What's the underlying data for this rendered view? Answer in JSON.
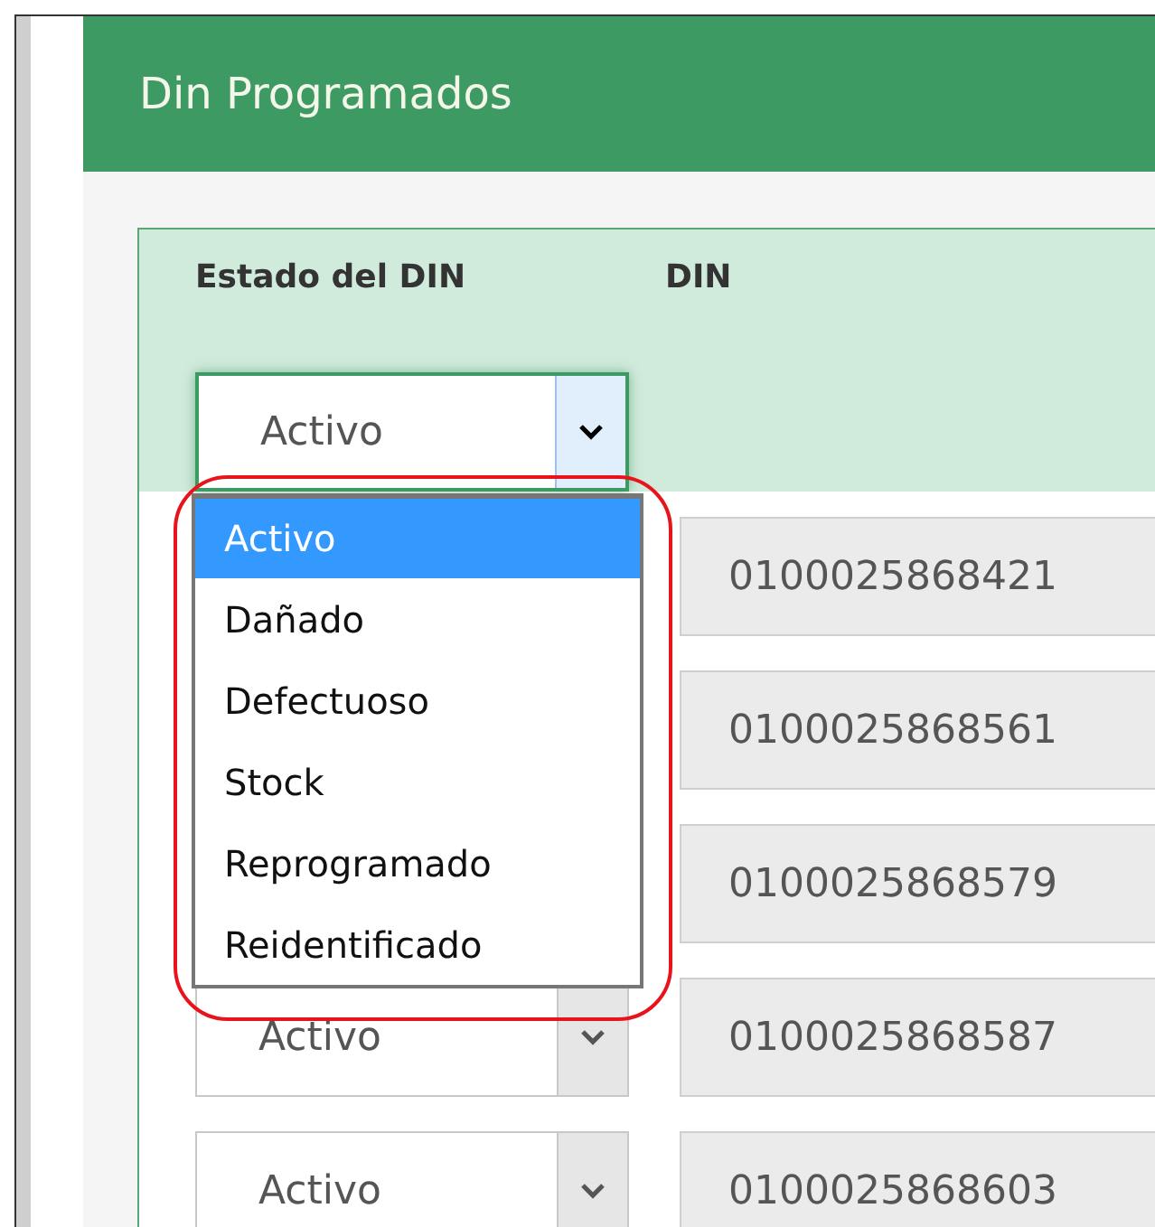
{
  "panel": {
    "title": "Din Programados"
  },
  "columns": [
    "Estado del DIN",
    "DIN"
  ],
  "filter": {
    "value": "Activo",
    "expanded": true,
    "options": [
      {
        "label": "Activo",
        "selected": true
      },
      {
        "label": "Dañado",
        "selected": false
      },
      {
        "label": "Defectuoso",
        "selected": false
      },
      {
        "label": "Stock",
        "selected": false
      },
      {
        "label": "Reprogramado",
        "selected": false
      },
      {
        "label": "Reidentificado",
        "selected": false
      }
    ]
  },
  "rows": [
    {
      "din": "0100025868421"
    },
    {
      "din": "0100025868561"
    },
    {
      "din": "0100025868579"
    },
    {
      "status": "Activo",
      "din": "0100025868587"
    },
    {
      "status": "Activo",
      "din": "0100025868603"
    }
  ]
}
